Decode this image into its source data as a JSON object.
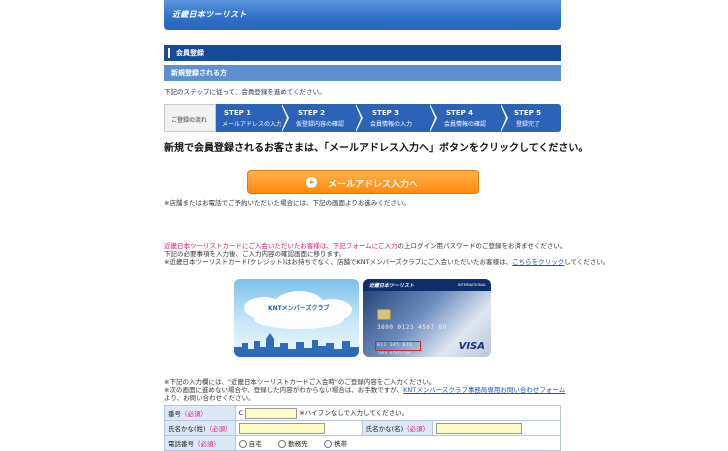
{
  "header": {
    "logo": "近畿日本ツーリスト"
  },
  "section_title": "会員登録",
  "sub_title": "新規登録される方",
  "intro": "下記のステップに従って、会員登録を進めてください。",
  "steps": {
    "first": "ご登録の流れ",
    "items": [
      {
        "num": "STEP 1",
        "label": "メールアドレスの入力"
      },
      {
        "num": "STEP 2",
        "label": "仮登録内容の確認"
      },
      {
        "num": "STEP 3",
        "label": "会員情報の入力"
      },
      {
        "num": "STEP 4",
        "label": "会員情報の確認"
      },
      {
        "num": "STEP 5",
        "label": "登録完了"
      }
    ]
  },
  "headline": "新規で会員登録されるお客さまは、「メールアドレス入力へ」ボタンをクリックしてください。",
  "cta_label": "メールアドレス入力へ",
  "note_store": "※店舗またはお電話でご予約いただいた場合には、下記の画面よりお進みください。",
  "card_notice": {
    "pink_link": "近畿日本ツーリストカードにご入会いただいたお客様は、下記フォームにご入力",
    "line1_rest": "の上ログイン用パスワードのご登録をお済ませください。",
    "line2": "下記の必要事項を入力後、ご入力内容の確認画面に移ります。",
    "line3_pre": "※近畿日本ツーリストカード(クレジット)はお持ちでなく、店舗でKNTメンバーズクラブにご入会いただいたお客様は、",
    "line3_link": "こちらをクリック",
    "line3_post": "してください。"
  },
  "cards": {
    "card1_label": "KNTメンバーズクラブ",
    "card2_brand": "近畿日本ツーリスト",
    "card2_intl": "INTERNATIONAL",
    "card2_number": "3800 0123 4567 89",
    "card2_sub": "012 345 678",
    "card2_name": "TARO KINTETSU",
    "card2_visa": "VISA"
  },
  "form_notes": {
    "line1": "※下記の入力欄には、\"近畿日本ツーリストカードご入会時\"のご登録内容をご入力ください。",
    "line2_pre": "※次の画面に進めない場合や、登録した内容がわからない場合は、お手数ですが、",
    "line2_link": "KNTメンバーズクラブ事務局専用お問い合わせフォーム",
    "line3": "より、お問い合わせください。"
  },
  "form": {
    "row1_label": "番号",
    "required": "（必須）",
    "row1_prefix": "C",
    "row1_hint": "※ハイフンなしで入力してください。",
    "row2_label": "氏名かな(姓)",
    "row2_label_b": "氏名かな(名)",
    "row3_label": "電話番号",
    "radio1": "自宅",
    "radio2": "勤務先",
    "radio3": "携帯"
  }
}
